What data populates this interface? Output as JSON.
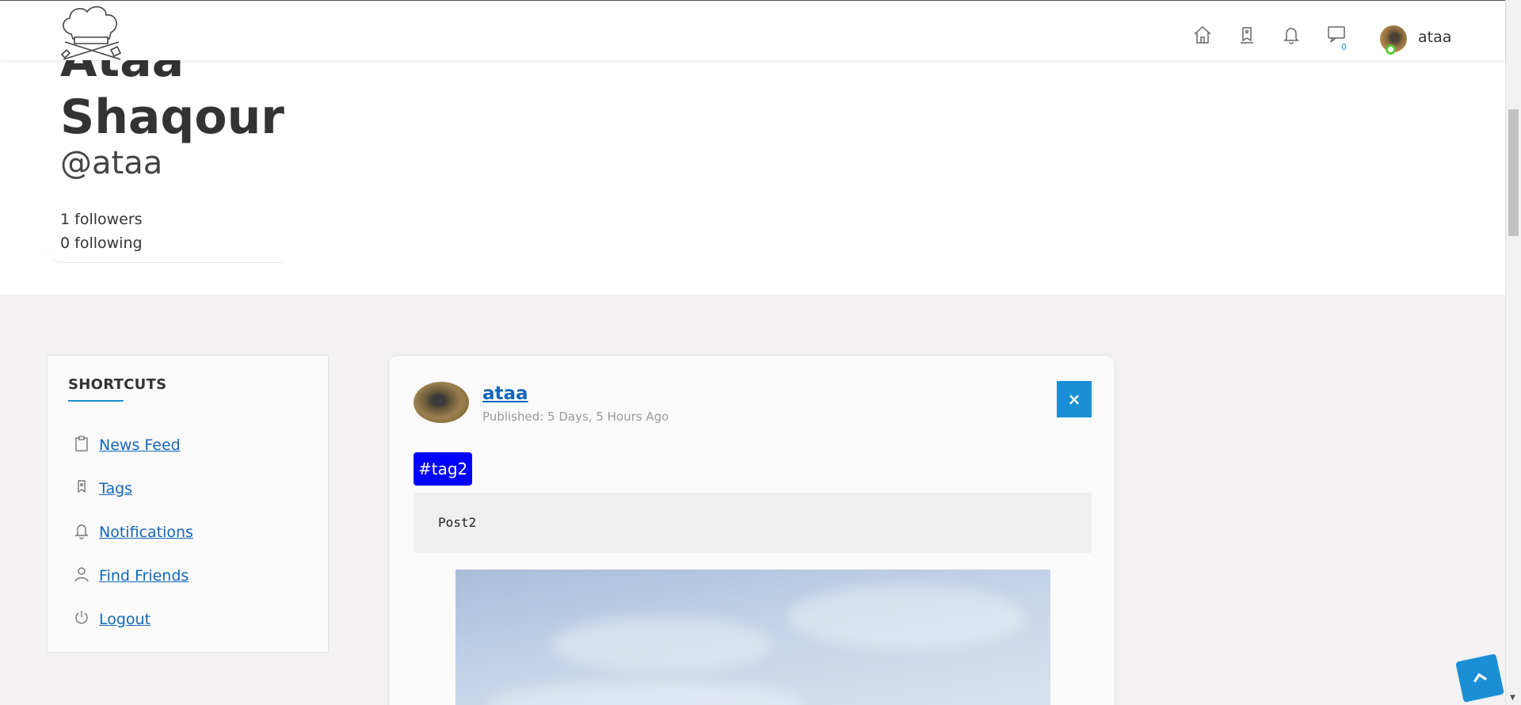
{
  "header": {
    "logo": "chef-hat-logo",
    "nav_icons": [
      "home-icon",
      "tag-icon",
      "bell-icon",
      "chat-icon"
    ],
    "message_count": "0",
    "username": "ataa"
  },
  "profile": {
    "name_line1": "Ataa",
    "name_line2": "Shaqour",
    "handle": "@ataa",
    "followers": "1 followers",
    "following": "0 following"
  },
  "shortcuts": {
    "title": "SHORTCUTS",
    "items": [
      {
        "label": "News Feed",
        "icon": "clipboard-icon"
      },
      {
        "label": "Tags",
        "icon": "tag-icon"
      },
      {
        "label": "Notifications",
        "icon": "bell-icon"
      },
      {
        "label": "Find Friends",
        "icon": "user-icon"
      },
      {
        "label": "Logout",
        "icon": "power-icon"
      }
    ]
  },
  "post": {
    "author": "ataa",
    "published": "Published: 5 Days, 5 Hours Ago",
    "close": "×",
    "tag": "#tag2",
    "text": "Post2"
  },
  "colors": {
    "accent": "#1a8fd6",
    "tag_bg": "#0000ff",
    "link": "#1466b8",
    "online": "#5ec43c"
  }
}
